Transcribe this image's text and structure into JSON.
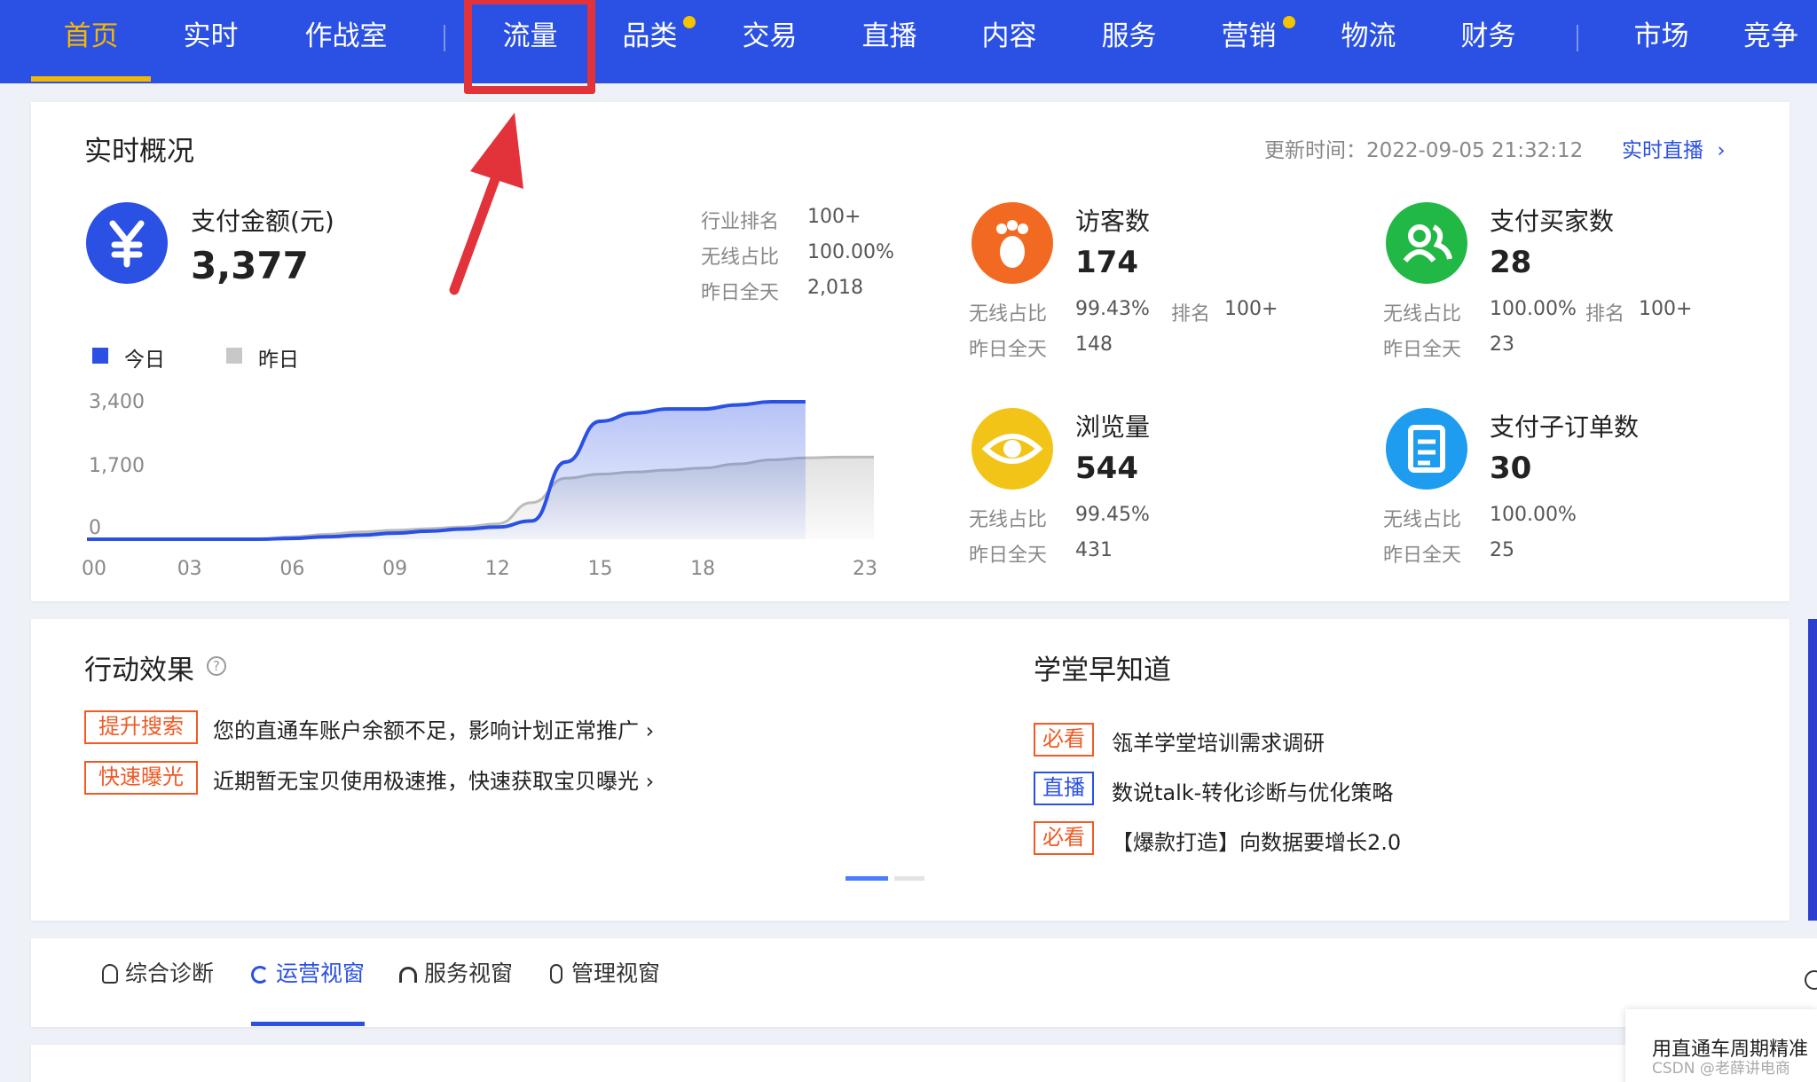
{
  "nav": {
    "items": [
      {
        "label": "首页",
        "active": true
      },
      {
        "label": "实时"
      },
      {
        "label": "作战室"
      },
      {
        "label": "流量"
      },
      {
        "label": "品类",
        "dot": true
      },
      {
        "label": "交易"
      },
      {
        "label": "直播"
      },
      {
        "label": "内容"
      },
      {
        "label": "服务"
      },
      {
        "label": "营销",
        "dot": true
      },
      {
        "label": "物流"
      },
      {
        "label": "财务"
      },
      {
        "label": "市场"
      },
      {
        "label": "竞争"
      }
    ]
  },
  "realtime": {
    "title": "实时概况",
    "update_label": "更新时间：2022-09-05 21:32:12",
    "live_link": "实时直播",
    "payment": {
      "label": "支付金额(元)",
      "value": "3,377",
      "rank_label": "行业排名",
      "rank_value": "100+",
      "wireless_label": "无线占比",
      "wireless_value": "100.00%",
      "yesterday_label": "昨日全天",
      "yesterday_value": "2,018"
    },
    "legend": {
      "today": "今日",
      "yesterday": "昨日"
    },
    "metrics": [
      {
        "label": "访客数",
        "value": "174",
        "wireless_label": "无线占比",
        "wireless_value": "99.43%",
        "rank_label": "排名",
        "rank_value": "100+",
        "yesterday_label": "昨日全天",
        "yesterday_value": "148",
        "color": "#f26a21",
        "icon": "footprint-icon"
      },
      {
        "label": "支付买家数",
        "value": "28",
        "wireless_label": "无线占比",
        "wireless_value": "100.00%",
        "rank_label": "排名",
        "rank_value": "100+",
        "yesterday_label": "昨日全天",
        "yesterday_value": "23",
        "color": "#22b845",
        "icon": "users-icon"
      },
      {
        "label": "浏览量",
        "value": "544",
        "wireless_label": "无线占比",
        "wireless_value": "99.45%",
        "yesterday_label": "昨日全天",
        "yesterday_value": "431",
        "color": "#f2c418",
        "icon": "eye-icon"
      },
      {
        "label": "支付子订单数",
        "value": "30",
        "wireless_label": "无线占比",
        "wireless_value": "100.00%",
        "yesterday_label": "昨日全天",
        "yesterday_value": "25",
        "color": "#1e9cf0",
        "icon": "clipboard-icon"
      }
    ]
  },
  "chart_data": {
    "type": "area",
    "x": [
      0,
      1,
      2,
      3,
      4,
      5,
      6,
      7,
      8,
      9,
      10,
      11,
      12,
      13,
      14,
      15,
      16,
      17,
      18,
      19,
      20,
      21,
      22,
      23
    ],
    "x_ticks": [
      "00",
      "03",
      "06",
      "09",
      "12",
      "15",
      "18",
      "23"
    ],
    "y_ticks": [
      "3,400",
      "1,700",
      "0"
    ],
    "ylim": [
      0,
      3400
    ],
    "series": [
      {
        "name": "今日",
        "color": "#2a50e4",
        "values": [
          0,
          0,
          0,
          0,
          0,
          0,
          20,
          60,
          100,
          150,
          200,
          250,
          300,
          450,
          1900,
          2900,
          3100,
          3200,
          3200,
          3300,
          3377,
          3377,
          null,
          null
        ]
      },
      {
        "name": "昨日",
        "color": "#bbbbbb",
        "values": [
          0,
          0,
          0,
          0,
          0,
          0,
          60,
          120,
          180,
          220,
          260,
          300,
          380,
          900,
          1500,
          1600,
          1650,
          1700,
          1750,
          1850,
          1950,
          2000,
          2018,
          2018
        ]
      }
    ]
  },
  "action": {
    "title": "行动效果",
    "items": [
      {
        "tag": "提升搜索",
        "text": "您的直通车账户余额不足，影响计划正常推广"
      },
      {
        "tag": "快速曝光",
        "text": "近期暂无宝贝使用极速推，快速获取宝贝曝光"
      }
    ]
  },
  "school": {
    "title": "学堂早知道",
    "items": [
      {
        "tag": "必看",
        "type": "orange",
        "text": "瓴羊学堂培训需求调研"
      },
      {
        "tag": "直播",
        "type": "blue",
        "text": "数说talk-转化诊断与优化策略"
      },
      {
        "tag": "必看",
        "type": "orange",
        "text": "【爆款打造】向数据要增长2.0"
      }
    ]
  },
  "tabs": [
    {
      "label": "综合诊断",
      "icon": "bulb-icon"
    },
    {
      "label": "运营视窗",
      "icon": "refresh-icon",
      "active": true
    },
    {
      "label": "服务视窗",
      "icon": "headset-icon"
    },
    {
      "label": "管理视窗",
      "icon": "medal-icon"
    }
  ],
  "popup_text": "用直通车周期精准",
  "watermark": "CSDN @老薛讲电商"
}
